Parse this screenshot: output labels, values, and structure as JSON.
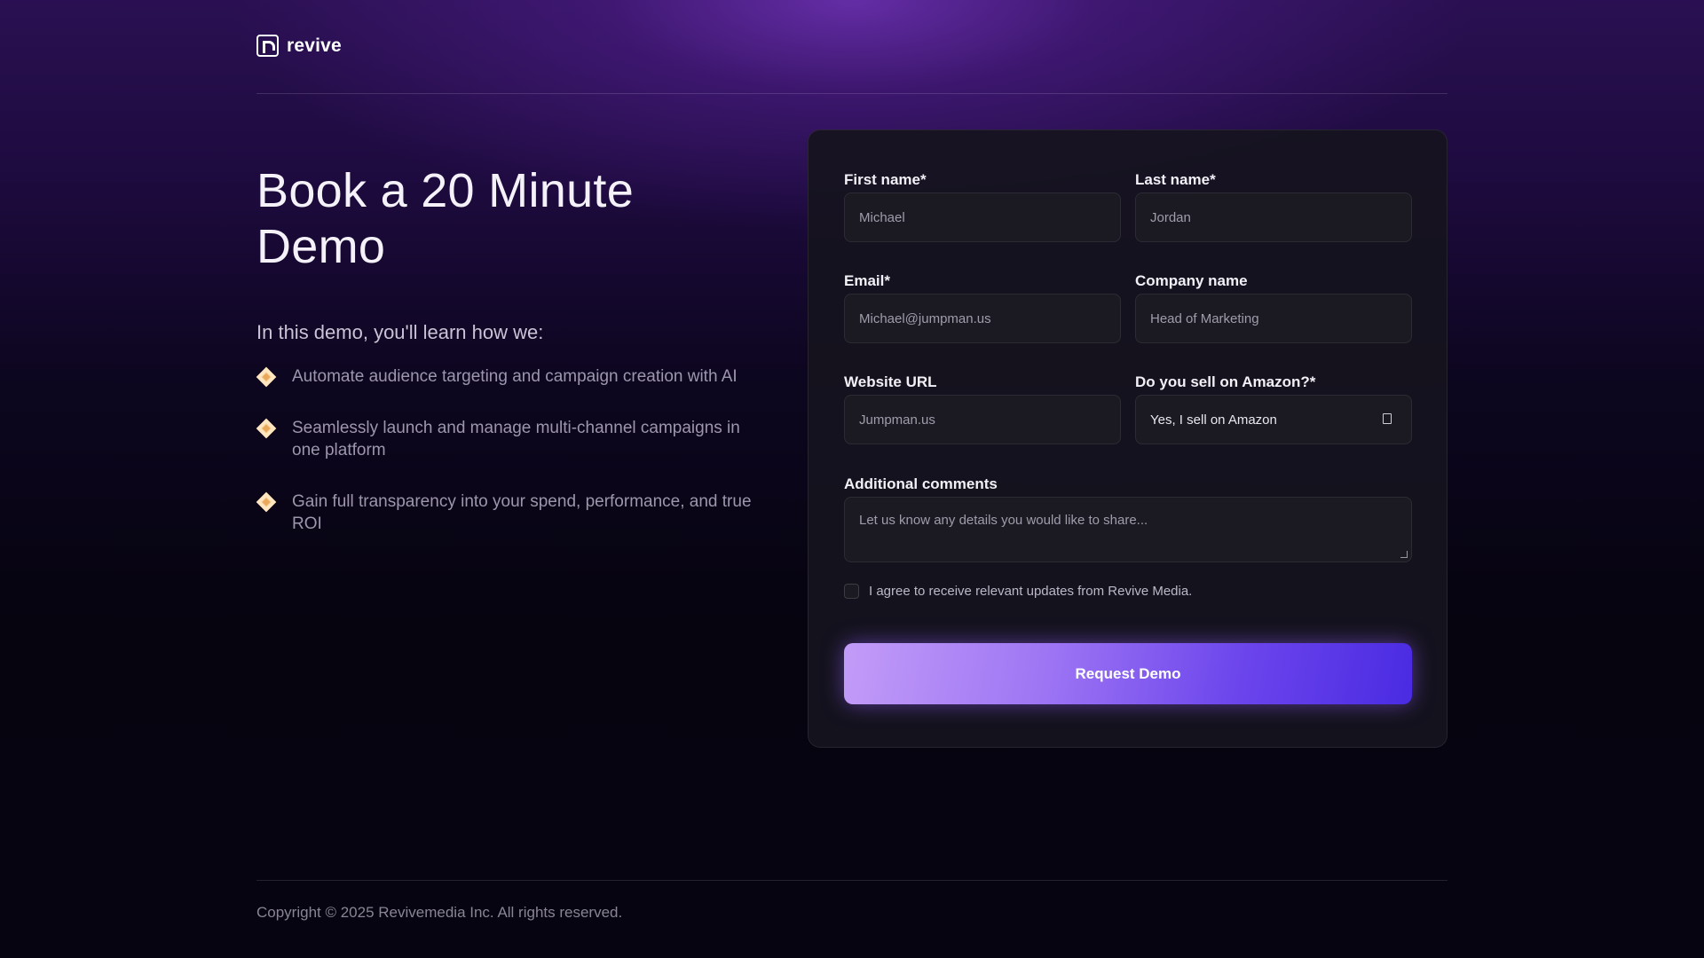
{
  "brand": {
    "name": "revive"
  },
  "hero": {
    "title_line1": "Book a 20 Minute",
    "title_line2": "Demo",
    "intro": "In this demo, you'll learn how we:",
    "bullets": [
      "Automate audience targeting and campaign creation with AI",
      "Seamlessly launch and manage multi-channel campaigns in one platform",
      "Gain full transparency into your spend, performance, and true ROI"
    ]
  },
  "form": {
    "first_name": {
      "label": "First name*",
      "placeholder": "Michael"
    },
    "last_name": {
      "label": "Last name*",
      "placeholder": "Jordan"
    },
    "email": {
      "label": "Email*",
      "placeholder": "Michael@jumpman.us"
    },
    "company": {
      "label": "Company name",
      "placeholder": "Head of Marketing"
    },
    "website": {
      "label": "Website URL",
      "placeholder": "Jumpman.us"
    },
    "amazon": {
      "label": "Do you sell on Amazon?*",
      "selected": "Yes, I sell on Amazon"
    },
    "comments": {
      "label": "Additional comments",
      "placeholder": "Let us know any details you would like to share..."
    },
    "consent": {
      "label": "I agree to receive relevant updates from Revive Media.",
      "checked": false
    },
    "submit_label": "Request Demo"
  },
  "footer": {
    "copyright": "Copyright © 2025 Revivemedia Inc. All rights reserved."
  },
  "colors": {
    "accent_start": "#c39cf8",
    "accent_end": "#4a2be2",
    "bullet_icon": "#f5c98c"
  },
  "icons": {
    "logo": "revive-logo-icon",
    "bullet": "diamond-icon",
    "select": "dropdown-icon"
  }
}
